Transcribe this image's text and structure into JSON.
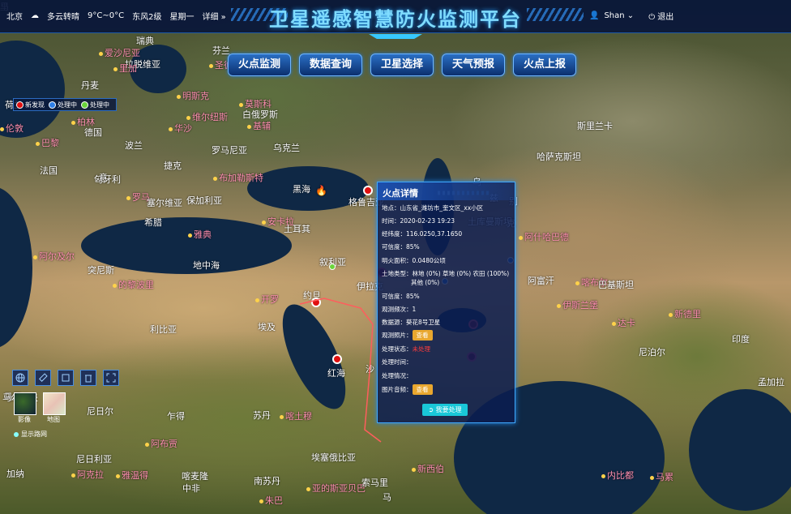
{
  "weather": {
    "city": "北京",
    "condition": "多云转晴",
    "temp": "9°C~0°C",
    "wind": "东风2级",
    "weekday": "星期一",
    "detail_label": "详细"
  },
  "title": "卫星遥感智慧防火监测平台",
  "user": {
    "name": "Shan",
    "logout": "退出"
  },
  "nav": [
    "火点监测",
    "数据查询",
    "卫星选择",
    "天气预报",
    "火点上报"
  ],
  "legend": {
    "new": "新发现",
    "processing1": "处理中",
    "processing2": "处理中"
  },
  "layers": {
    "image": "影像",
    "map": "地图",
    "route": "显示路网"
  },
  "places": [
    {
      "t": "瑞典",
      "c": "w"
    },
    {
      "t": "芬兰",
      "c": "w"
    },
    {
      "t": "爱沙尼亚",
      "c": "p"
    },
    {
      "t": "圣彼得堡",
      "c": "p"
    },
    {
      "t": "丹麦",
      "c": "w"
    },
    {
      "t": "拉脱维亚",
      "c": "w"
    },
    {
      "t": "里加",
      "c": "p"
    },
    {
      "t": "莫斯科",
      "c": "p"
    },
    {
      "t": "维尔纽斯",
      "c": "p"
    },
    {
      "t": "明斯克",
      "c": "p"
    },
    {
      "t": "白俄罗斯",
      "c": "w"
    },
    {
      "t": "荷兰",
      "c": "w"
    },
    {
      "t": "柏林",
      "c": "p"
    },
    {
      "t": "德国",
      "c": "w"
    },
    {
      "t": "华沙",
      "c": "p"
    },
    {
      "t": "波兰",
      "c": "w"
    },
    {
      "t": "基辅",
      "c": "p"
    },
    {
      "t": "乌克兰",
      "c": "w"
    },
    {
      "t": "伦敦",
      "c": "p"
    },
    {
      "t": "巴黎",
      "c": "p"
    },
    {
      "t": "法国",
      "c": "w"
    },
    {
      "t": "捷克",
      "c": "w"
    },
    {
      "t": "匈牙利",
      "c": "w"
    },
    {
      "t": "罗马尼亚",
      "c": "w"
    },
    {
      "t": "布加勒斯特",
      "c": "p"
    },
    {
      "t": "意",
      "c": "w"
    },
    {
      "t": "罗马",
      "c": "p"
    },
    {
      "t": "塞尔维亚",
      "c": "w"
    },
    {
      "t": "保加利亚",
      "c": "w"
    },
    {
      "t": "希腊",
      "c": "w"
    },
    {
      "t": "雅典",
      "c": "p"
    },
    {
      "t": "安卡拉",
      "c": "p"
    },
    {
      "t": "土耳其",
      "c": "w"
    },
    {
      "t": "黑海",
      "c": "w"
    },
    {
      "t": "格鲁吉亚",
      "c": "w"
    },
    {
      "t": "叙利亚",
      "c": "w"
    },
    {
      "t": "伊拉克",
      "c": "w"
    },
    {
      "t": "约旦",
      "c": "w"
    },
    {
      "t": "开罗",
      "c": "p"
    },
    {
      "t": "埃及",
      "c": "w"
    },
    {
      "t": "地中海",
      "c": "w"
    },
    {
      "t": "突尼斯",
      "c": "w"
    },
    {
      "t": "的黎波里",
      "c": "p"
    },
    {
      "t": "利比亚",
      "c": "w"
    },
    {
      "t": "阿尔及尔",
      "c": "p"
    },
    {
      "t": "红海",
      "c": "w"
    },
    {
      "t": "沙",
      "c": "w"
    },
    {
      "t": "苏丹",
      "c": "w"
    },
    {
      "t": "喀土穆",
      "c": "p"
    },
    {
      "t": "乍得",
      "c": "w"
    },
    {
      "t": "尼日尔",
      "c": "w"
    },
    {
      "t": "马里",
      "c": "w"
    },
    {
      "t": "尼日利亚",
      "c": "w"
    },
    {
      "t": "阿布贾",
      "c": "p"
    },
    {
      "t": "加纳",
      "c": "w"
    },
    {
      "t": "阿克拉",
      "c": "p"
    },
    {
      "t": "喀麦隆",
      "c": "w"
    },
    {
      "t": "雅温得",
      "c": "p"
    },
    {
      "t": "中非",
      "c": "w"
    },
    {
      "t": "南苏丹",
      "c": "w"
    },
    {
      "t": "朱巴",
      "c": "p"
    },
    {
      "t": "埃塞俄比亚",
      "c": "w"
    },
    {
      "t": "亚的斯亚贝巴",
      "c": "p"
    },
    {
      "t": "索马里",
      "c": "w"
    },
    {
      "t": "哈萨克斯坦",
      "c": "w"
    },
    {
      "t": "土库曼斯坦",
      "c": "w"
    },
    {
      "t": "阿什哈巴德",
      "c": "p"
    },
    {
      "t": "乌",
      "c": "w"
    },
    {
      "t": "克",
      "c": "w"
    },
    {
      "t": "兹",
      "c": "w"
    },
    {
      "t": "别",
      "c": "w"
    },
    {
      "t": "阿富汗",
      "c": "w"
    },
    {
      "t": "喀布尔",
      "c": "p"
    },
    {
      "t": "伊斯兰堡",
      "c": "p"
    },
    {
      "t": "巴基斯坦",
      "c": "w"
    },
    {
      "t": "新德里",
      "c": "p"
    },
    {
      "t": "尼泊尔",
      "c": "w"
    },
    {
      "t": "印度",
      "c": "w"
    },
    {
      "t": "孟加拉",
      "c": "w"
    },
    {
      "t": "达卡",
      "c": "p"
    },
    {
      "t": "内比都",
      "c": "p"
    },
    {
      "t": "马累",
      "c": "p"
    },
    {
      "t": "斯里兰卡",
      "c": "w"
    },
    {
      "t": "马尔代夫",
      "c": "w"
    },
    {
      "t": "新西伯",
      "c": "p"
    },
    {
      "t": "马",
      "c": "w"
    },
    {
      "t": "里",
      "c": "w"
    },
    {
      "t": "马",
      "c": "w"
    }
  ],
  "popup": {
    "title": "火点详情",
    "address": "地点：山东省_潍坊市_奎文区_xx小区",
    "time": "时间：2020-02-23 19:23",
    "lnglat": "经纬度：116.0250,37.1650",
    "confidence1": "可信度：85%",
    "area": "明火面积：0.0480公顷",
    "landtype1": "土地类型：林地 (0%) 草地 (0%) 农田 (100%)",
    "landtype2": "其他 (0%)",
    "confidence2": "可信度：85%",
    "frequency": "观测频次：1",
    "source": "数据源：葵花8号卫星",
    "photo_label": "观测照片：",
    "view1": "查看",
    "status_label": "处理状态：",
    "status_value": "未处理",
    "handle_time": "处理时间：",
    "handle_info": "处理情况：",
    "media_label": "图片音频：",
    "view2": "查看",
    "action": "我要处理"
  },
  "colors": {
    "accent": "#37c8ff",
    "header": "#08163a",
    "status_red": "#e01010",
    "status_blue": "#2f7fe8",
    "status_green": "#6ad43b",
    "button_orange": "#e9a72e",
    "button_cyan": "#19c7d8"
  }
}
